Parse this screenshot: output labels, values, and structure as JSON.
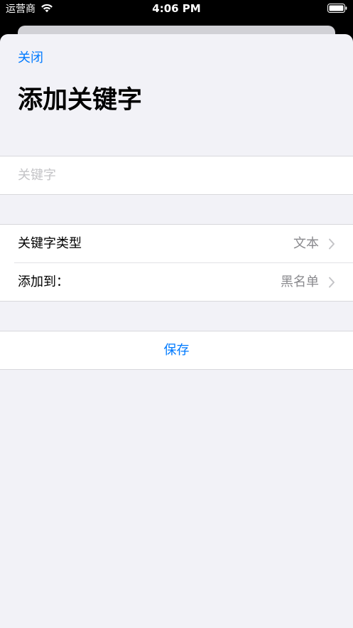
{
  "status_bar": {
    "carrier": "运营商",
    "time": "4:06 PM",
    "icons": [
      "wifi-icon",
      "battery-icon"
    ]
  },
  "sheet": {
    "close_label": "关闭",
    "title": "添加关键字"
  },
  "keyword": {
    "value": "",
    "placeholder": "关键字"
  },
  "options": {
    "rows": [
      {
        "label": "关键字类型",
        "value": "文本"
      },
      {
        "label": "添加到：",
        "value": "黑名单"
      }
    ]
  },
  "actions": {
    "save_label": "保存"
  },
  "colors": {
    "accent": "#007aff",
    "sheet_background": "#f2f2f7",
    "secondary_text": "#8a8a8e",
    "placeholder_text": "#c4c4c7"
  }
}
